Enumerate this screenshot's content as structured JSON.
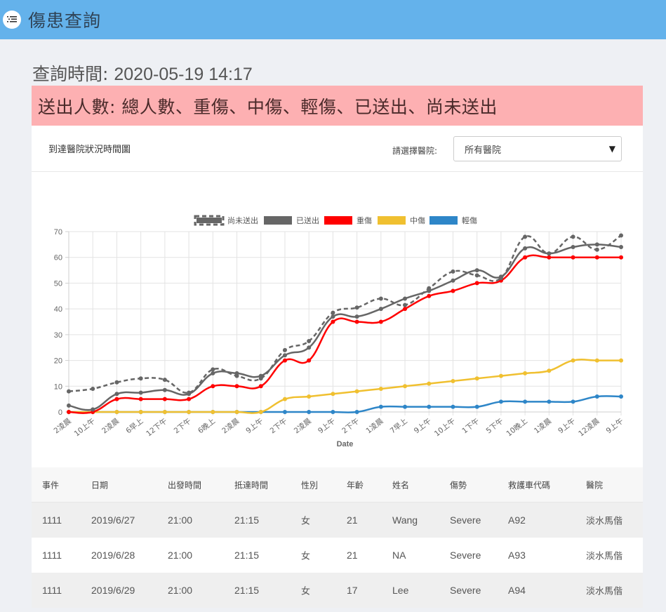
{
  "header": {
    "title": "傷患查詢",
    "menu_icon": "menu-list-icon"
  },
  "query": {
    "label": "查詢時間: ",
    "time": "2020-05-19 14:17"
  },
  "alert": {
    "text": "送出人數: 總人數、重傷、中傷、輕傷、已送出、尚未送出"
  },
  "panel": {
    "title": "到達醫院狀況時間圖",
    "select_label": "請選擇醫院:",
    "select_value": "所有醫院"
  },
  "colors": {
    "unsent": "#666666",
    "sent": "#666666",
    "severe": "#ff0000",
    "moderate": "#f0c030",
    "minor": "#2e86c8",
    "header_bg": "#64b2eb",
    "alert_bg": "#fdb0b2"
  },
  "chart_data": {
    "type": "line",
    "xlabel": "Date",
    "ylabel": "",
    "ylim": [
      0,
      70
    ],
    "yticks": [
      0,
      10,
      20,
      30,
      40,
      50,
      60,
      70
    ],
    "legend_position": "top",
    "categories": [
      "2凌晨",
      "10上午",
      "2凌晨",
      "6早上",
      "12下午",
      "2下午",
      "6晚上",
      "2凌晨",
      "9上午",
      "2下午",
      "2凌晨",
      "9上午",
      "2下午",
      "1凌晨",
      "7早上",
      "9上午",
      "10上午",
      "1下午",
      "5下午",
      "10晚上",
      "1凌晨",
      "9上午",
      "12凌晨",
      "9上午"
    ],
    "series": [
      {
        "name": "尚未送出",
        "style": "dashed",
        "values": [
          8,
          9,
          11.5,
          13,
          12.5,
          7.5,
          16.5,
          14,
          13,
          24,
          27.5,
          38.5,
          40.5,
          44,
          41.5,
          48,
          54.5,
          53,
          52,
          68,
          61.5,
          68,
          63,
          68.5
        ]
      },
      {
        "name": "已送出",
        "style": "solid",
        "values": [
          2.5,
          1,
          7,
          7.5,
          8.5,
          7,
          15,
          15,
          14,
          22,
          25,
          37,
          37,
          40,
          44,
          47,
          51,
          55,
          52.5,
          63.5,
          61.5,
          64,
          65,
          64
        ]
      },
      {
        "name": "重傷",
        "style": "solid",
        "values": [
          0,
          0,
          5,
          5,
          5,
          5,
          10,
          10,
          10,
          20,
          20,
          35,
          35,
          35,
          40,
          45,
          47,
          50,
          51,
          60,
          60,
          60,
          60,
          60
        ]
      },
      {
        "name": "中傷",
        "style": "solid",
        "values": [
          0,
          0,
          0,
          0,
          0,
          0,
          0,
          0,
          0,
          5,
          6,
          7,
          8,
          9,
          10,
          11,
          12,
          13,
          14,
          15,
          16,
          20,
          20,
          20
        ]
      },
      {
        "name": "輕傷",
        "style": "solid",
        "values": [
          0,
          0,
          0,
          0,
          0,
          0,
          0,
          0,
          0,
          0,
          0,
          0,
          0,
          2,
          2,
          2,
          2,
          2,
          4,
          4,
          4,
          4,
          6,
          6
        ]
      }
    ]
  },
  "table": {
    "columns": [
      "事件",
      "日期",
      "出發時間",
      "抵達時間",
      "性別",
      "年齡",
      "姓名",
      "傷勢",
      "救護車代碼",
      "醫院"
    ],
    "rows": [
      [
        "1111",
        "2019/6/27",
        "21:00",
        "21:15",
        "女",
        "21",
        "Wang",
        "Severe",
        "A92",
        "淡水馬偕"
      ],
      [
        "1111",
        "2019/6/28",
        "21:00",
        "21:15",
        "女",
        "21",
        "NA",
        "Severe",
        "A93",
        "淡水馬偕"
      ],
      [
        "1111",
        "2019/6/29",
        "21:00",
        "21:15",
        "女",
        "17",
        "Lee",
        "Severe",
        "A94",
        "淡水馬偕"
      ]
    ]
  }
}
